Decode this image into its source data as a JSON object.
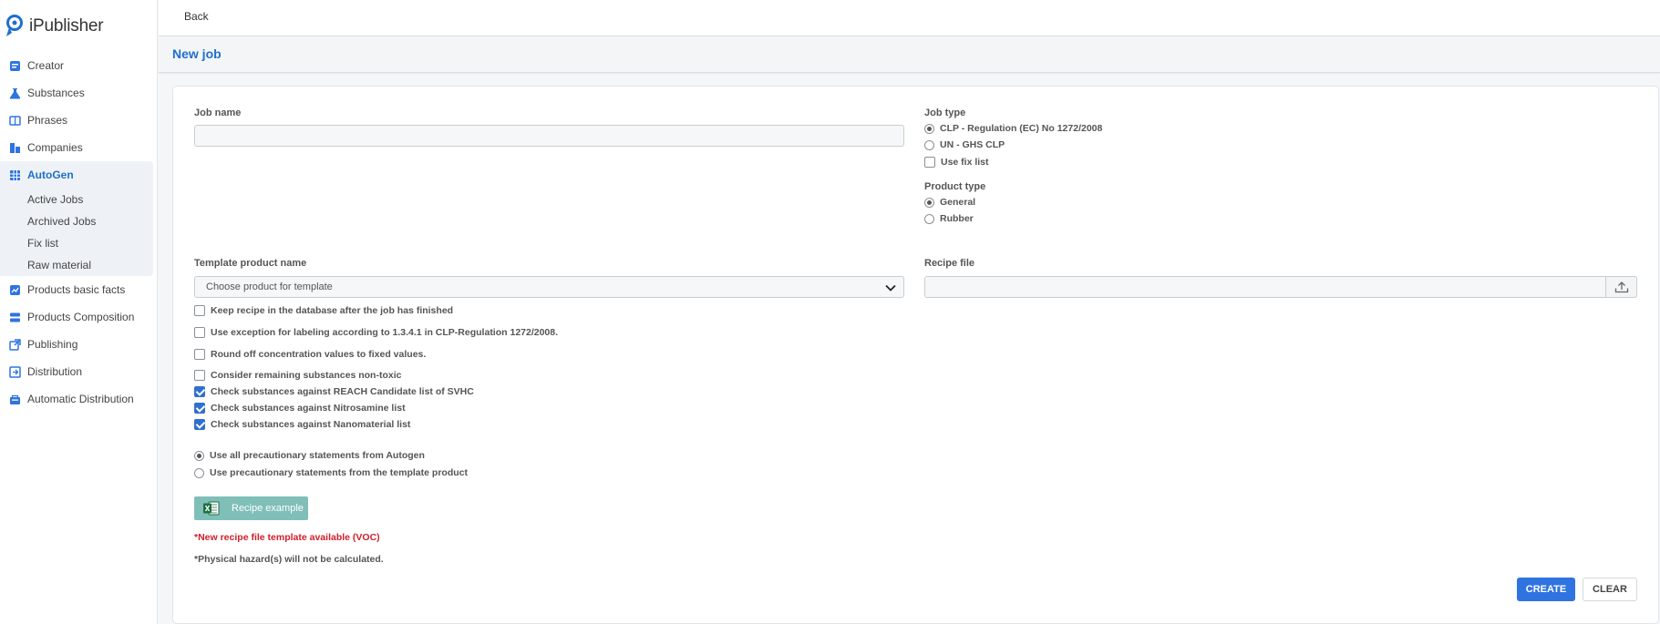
{
  "app": {
    "name": "iPublisher",
    "logo_icon": "ipublisher-logo-icon"
  },
  "sidebar": {
    "items": [
      {
        "label": "Creator",
        "icon": "creator-icon"
      },
      {
        "label": "Substances",
        "icon": "flask-icon"
      },
      {
        "label": "Phrases",
        "icon": "book-icon"
      },
      {
        "label": "Companies",
        "icon": "building-icon"
      },
      {
        "label": "AutoGen",
        "icon": "grid-icon",
        "active": true
      },
      {
        "label": "Products basic facts",
        "icon": "chart-icon"
      },
      {
        "label": "Products Composition",
        "icon": "stack-icon"
      },
      {
        "label": "Publishing",
        "icon": "publish-icon"
      },
      {
        "label": "Distribution",
        "icon": "distribution-icon"
      },
      {
        "label": "Automatic Distribution",
        "icon": "auto-distribution-icon"
      }
    ],
    "autogen_sub": [
      "Active Jobs",
      "Archived Jobs",
      "Fix list",
      "Raw material"
    ]
  },
  "topbar": {
    "back_label": "Back"
  },
  "page": {
    "title": "New job"
  },
  "form": {
    "job_name_label": "Job name",
    "job_name_value": "",
    "job_type_label": "Job type",
    "job_type_options": [
      "CLP - Regulation (EC) No 1272/2008",
      "UN - GHS CLP"
    ],
    "job_type_selected": 0,
    "use_fix_list_label": "Use fix list",
    "use_fix_list_checked": false,
    "product_type_label": "Product type",
    "product_type_options": [
      "General",
      "Rubber"
    ],
    "product_type_selected": 0,
    "template_product_label": "Template product name",
    "template_product_placeholder": "Choose product for template",
    "recipe_file_label": "Recipe file",
    "recipe_file_value": "",
    "checkboxes": [
      {
        "label": "Keep recipe in the database after the job has finished",
        "checked": false
      },
      {
        "label": "Use exception for labeling according to 1.3.4.1 in CLP-Regulation 1272/2008.",
        "checked": false
      },
      {
        "label": "Round off concentration values to fixed values.",
        "checked": false
      },
      {
        "label": "Consider remaining substances non-toxic",
        "checked": false
      },
      {
        "label": "Check substances against REACH Candidate list of SVHC",
        "checked": true
      },
      {
        "label": "Check substances against Nitrosamine list",
        "checked": true
      },
      {
        "label": "Check substances against Nanomaterial list",
        "checked": true
      }
    ],
    "precautionary_options": [
      "Use all precautionary statements from Autogen",
      "Use precautionary statements from the template product"
    ],
    "precautionary_selected": 0,
    "recipe_example_label": "Recipe example",
    "recipe_example_icon": "excel-icon",
    "note_new_template": "*New recipe file template available (VOC)",
    "note_physical": "*Physical hazard(s) will not be calculated.",
    "create_label": "CREATE",
    "clear_label": "CLEAR"
  },
  "colors": {
    "accent": "#1f6fcc",
    "primary_button": "#2f73e0",
    "recipe_button": "#7fbfb8",
    "warning_text": "#d0202a"
  }
}
